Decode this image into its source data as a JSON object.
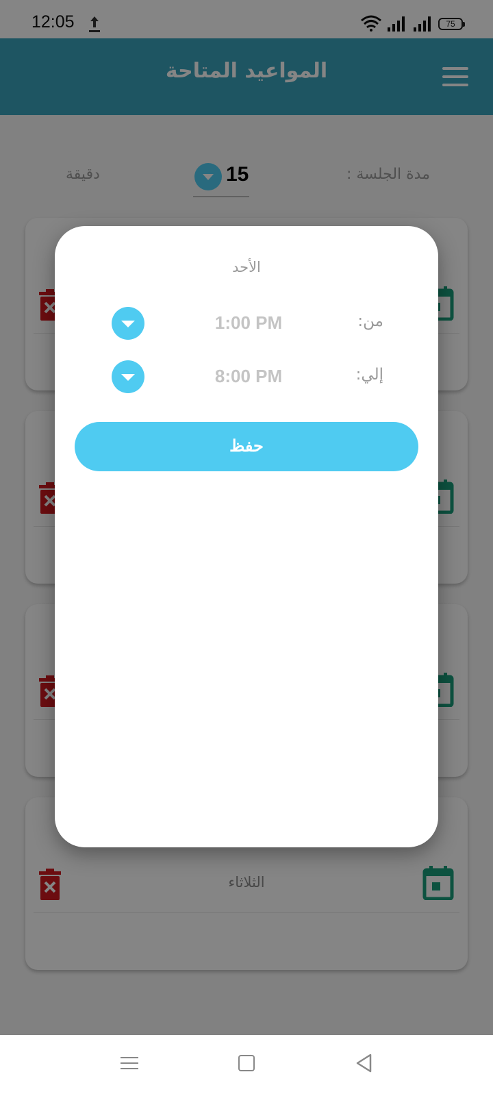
{
  "status_bar": {
    "time": "12:05",
    "battery": "75",
    "icons": [
      "upload-icon",
      "wifi-icon",
      "signal-icon",
      "signal-icon",
      "battery-icon"
    ]
  },
  "app_bar": {
    "title": "المواعيد المتاحة",
    "menu_icon": "menu-icon"
  },
  "session": {
    "label": "مدة الجلسة :",
    "value": "15",
    "unit": "دقيقة"
  },
  "days": [
    {
      "title": ""
    },
    {
      "title": ""
    },
    {
      "title": ""
    },
    {
      "title": "الثلاثاء"
    }
  ],
  "dialog": {
    "day": "الأحد",
    "from_label": "من:",
    "from_value": "1:00 PM",
    "to_label": "إلي:",
    "to_value": "8:00 PM",
    "save_label": "حفظ"
  },
  "colors": {
    "app_bar": "#3aa3bd",
    "accent": "#4fcbf1",
    "delete": "#d0191f",
    "calendar": "#1a9e7c"
  },
  "nav_bar": {
    "icons": [
      "recents-icon",
      "home-icon",
      "back-icon"
    ]
  }
}
